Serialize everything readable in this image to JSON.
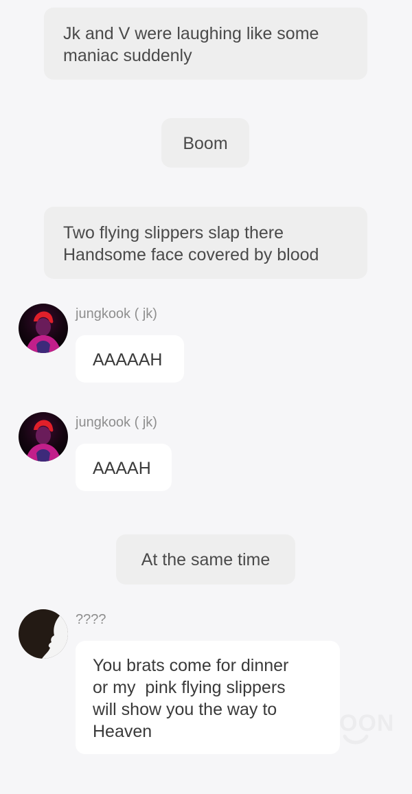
{
  "narrations": [
    {
      "lines": [
        "Jk and V were laughing like some",
        "maniac suddenly"
      ]
    },
    {
      "lines": [
        "Boom"
      ]
    },
    {
      "lines": [
        "Two flying slippers slap there",
        "Handsome face covered by blood"
      ]
    },
    {
      "lines": [
        "At the same time"
      ]
    }
  ],
  "messages": [
    {
      "sender": "jungkook ( jk)",
      "avatar": "jungkook-avatar",
      "lines": [
        "AAAAAH"
      ]
    },
    {
      "sender": "jungkook ( jk)",
      "avatar": "jungkook-avatar",
      "lines": [
        "AAAAH"
      ]
    },
    {
      "sender": "????",
      "avatar": "silhouette-avatar",
      "lines": [
        "You brats come for dinner",
        "or my  pink flying slippers",
        "will show you the way to",
        "Heaven"
      ]
    }
  ],
  "watermark": {
    "text": "OON"
  }
}
